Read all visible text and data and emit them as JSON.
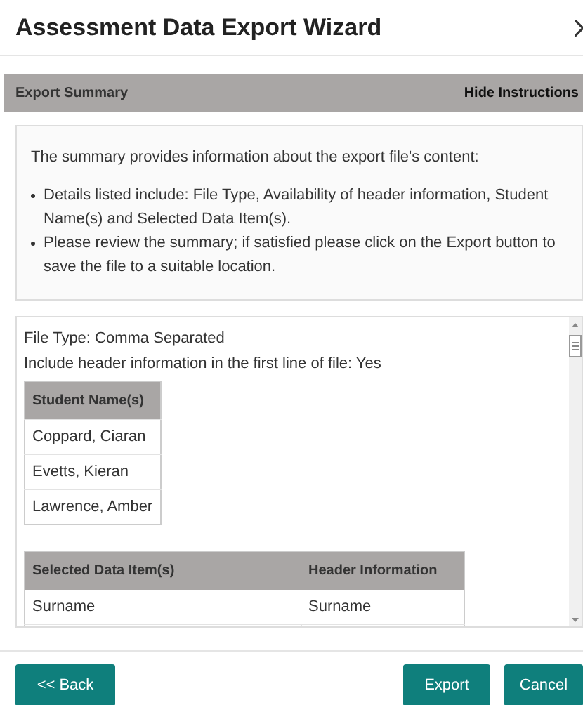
{
  "window": {
    "title": "Assessment Data Export Wizard"
  },
  "section_bar": {
    "title": "Export Summary",
    "toggle": "Hide Instructions"
  },
  "instructions": {
    "intro": "The summary provides information about the export file's content:",
    "bullets": [
      "Details listed include: File Type, Availability of header information, Student Name(s) and Selected Data Item(s).",
      "Please review the summary; if satisfied please click on the Export button to save the file to a suitable location."
    ]
  },
  "summary": {
    "file_type": "File Type: Comma Separated",
    "header_line": "Include header information in the first line of file: Yes",
    "students": {
      "columns": [
        "Student Name(s)"
      ],
      "rows": [
        "Coppard, Ciaran",
        "Evetts, Kieran",
        "Lawrence, Amber"
      ]
    },
    "data_items": {
      "columns": [
        "Selected Data Item(s)",
        "Header Information"
      ],
      "rows": [
        [
          "Surname",
          "Surname"
        ]
      ]
    }
  },
  "buttons": {
    "back": "<< Back",
    "export": "Export",
    "cancel": "Cancel"
  }
}
